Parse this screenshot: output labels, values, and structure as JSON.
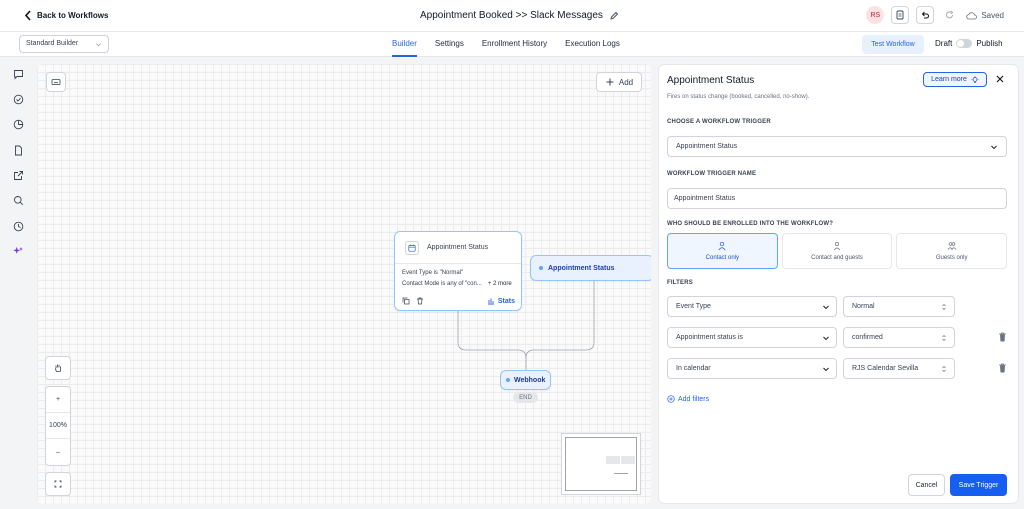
{
  "header": {
    "back_label": "Back to Workflows",
    "title": "Appointment Booked >> Slack Messages",
    "avatar_initials": "RS",
    "saved_label": "Saved"
  },
  "subbar": {
    "builder_select": "Standard Builder",
    "tabs": [
      {
        "label": "Builder",
        "active": true
      },
      {
        "label": "Settings",
        "active": false
      },
      {
        "label": "Enrollment History",
        "active": false
      },
      {
        "label": "Execution Logs",
        "active": false
      }
    ],
    "test_label": "Test Workflow",
    "draft_label": "Draft",
    "publish_label": "Publish"
  },
  "canvas": {
    "add_label": "Add",
    "zoom_level": "100%",
    "zoom_in": "+",
    "zoom_out": "–",
    "main_node": {
      "title": "Appointment Status",
      "line1": "Event Type is \"Normal\"",
      "line2": "Contact Mode is any of \"con...",
      "more": "+ 2 more",
      "stats_label": "Stats"
    },
    "trigger_node_label": "Appointment Status",
    "webhook_label": "Webhook",
    "end_label": "END"
  },
  "panel": {
    "title": "Appointment Status",
    "learn_more": "Learn more",
    "description": "Fires on status change (booked, cancelled, no-show).",
    "choose_label": "CHOOSE A WORKFLOW TRIGGER",
    "trigger_value": "Appointment Status",
    "name_label": "WORKFLOW TRIGGER NAME",
    "name_value": "Appointment Status",
    "enroll_label": "WHO SHOULD BE ENROLLED INTO THE WORKFLOW?",
    "enroll_options": [
      {
        "label": "Contact only",
        "selected": true
      },
      {
        "label": "Contact and guests",
        "selected": false
      },
      {
        "label": "Guests only",
        "selected": false
      }
    ],
    "filters_label": "FILTERS",
    "filters": [
      {
        "field": "Event Type",
        "value": "Normal"
      },
      {
        "field": "Appointment status is",
        "value": "confirmed"
      },
      {
        "field": "In calendar",
        "value": "RJS Calendar Sevilla"
      }
    ],
    "add_filters": "Add filters",
    "cancel_label": "Cancel",
    "save_label": "Save Trigger"
  },
  "colors": {
    "accent": "#2563eb",
    "primary_button": "#155eef",
    "node_border": "#93c5fd"
  }
}
